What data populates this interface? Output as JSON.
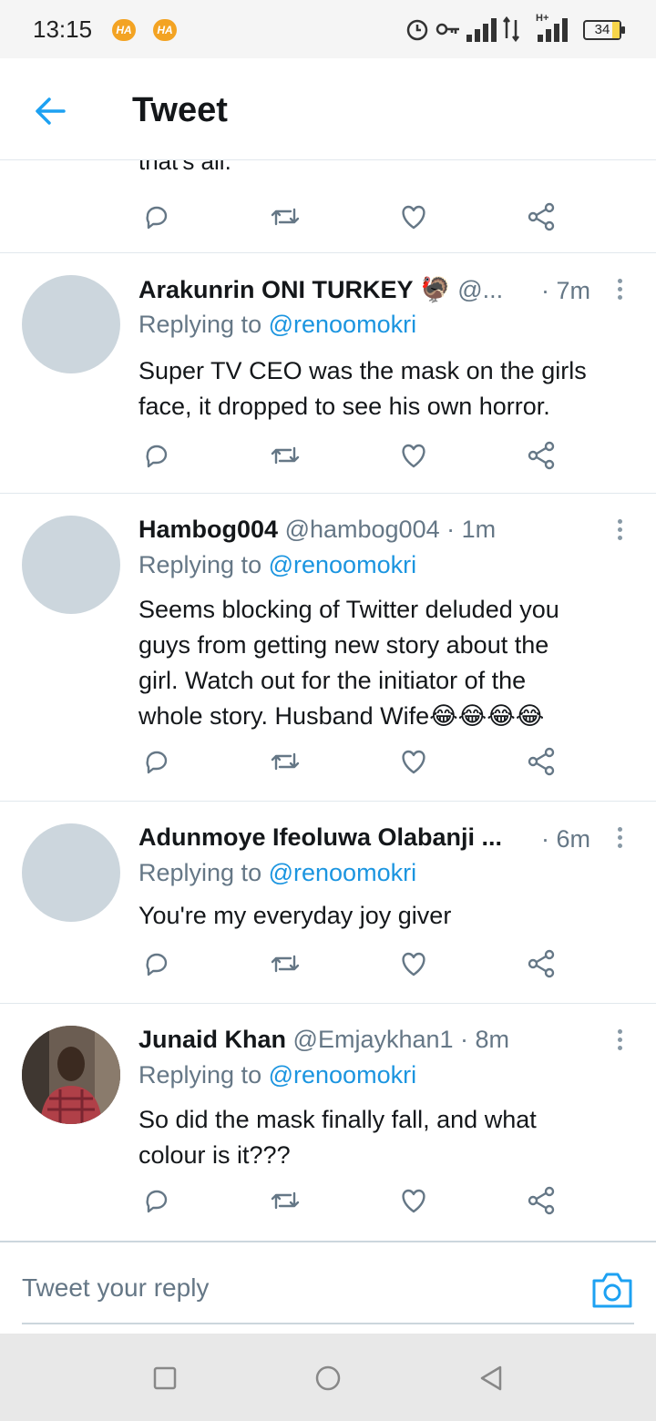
{
  "status_bar": {
    "time": "13:15",
    "badges": [
      "HA",
      "HA"
    ],
    "battery": "34",
    "network_label": "H+"
  },
  "header": {
    "title": "Tweet"
  },
  "partial_tweet": {
    "text": "that's all."
  },
  "tweets": [
    {
      "name": "Arakunrin ONI TURKEY",
      "emoji": "🦃",
      "handle": "@...",
      "time": "· 7m",
      "replying_label": "Replying to",
      "replying_to": "@renoomokri",
      "body_lines": [
        "Super TV CEO was the mask on the girls",
        "face, it dropped to see his own horror."
      ]
    },
    {
      "name": "Hambog004",
      "emoji": "",
      "handle": "@hambog004 · 1m",
      "time": "",
      "replying_label": "Replying to",
      "replying_to": "@renoomokri",
      "body_lines": [
        "Seems blocking of Twitter deluded you",
        "guys from getting new story about the",
        "girl. Watch out for the initiator of the",
        "whole story. Husband Wife😂😂😂😂"
      ]
    },
    {
      "name": "Adunmoye Ifeoluwa Olabanji ...",
      "emoji": "",
      "handle": "",
      "time": "· 6m",
      "replying_label": "Replying to",
      "replying_to": "@renoomokri",
      "body_lines": [
        "You're my everyday joy giver"
      ]
    },
    {
      "name": "Junaid Khan",
      "emoji": "",
      "handle": "@Emjaykhan1 · 8m",
      "time": "",
      "replying_label": "Replying to",
      "replying_to": "@renoomokri",
      "body_lines": [
        "So did the mask finally fall, and what",
        "colour is it???"
      ]
    }
  ],
  "composer": {
    "placeholder": "Tweet your reply"
  },
  "colors": {
    "accent": "#1da1f2",
    "mention": "#1b95e0",
    "secondary_text": "#657786",
    "divider": "#e1e8ed"
  },
  "icons": {
    "back": "arrow-left-icon",
    "reply": "reply-bubble-icon",
    "retweet": "retweet-icon",
    "like": "heart-icon",
    "share": "share-icon",
    "more": "more-vertical-icon",
    "camera": "camera-icon"
  }
}
